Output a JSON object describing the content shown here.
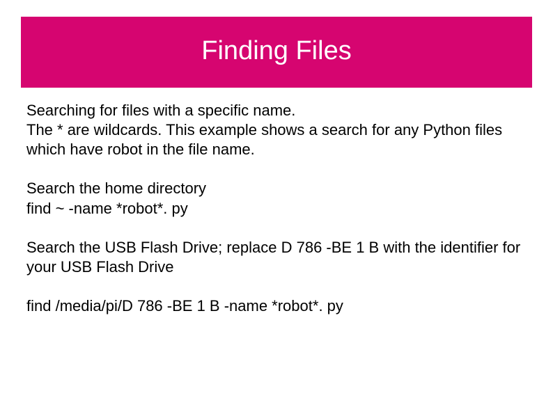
{
  "header": {
    "title": "Finding Files"
  },
  "content": {
    "block1": {
      "line1": "Searching for files with a specific name.",
      "line2": "The * are wildcards.  This example shows a search for any Python files which have robot in the file name."
    },
    "block2": {
      "line1": "Search the home directory",
      "line2": "find ~ -name *robot*. py"
    },
    "block3": {
      "line1": "Search the USB Flash Drive; replace D 786 -BE 1 B with the identifier for your USB Flash Drive"
    },
    "block4": {
      "line1": "find /media/pi/D 786 -BE 1 B -name *robot*. py"
    }
  }
}
